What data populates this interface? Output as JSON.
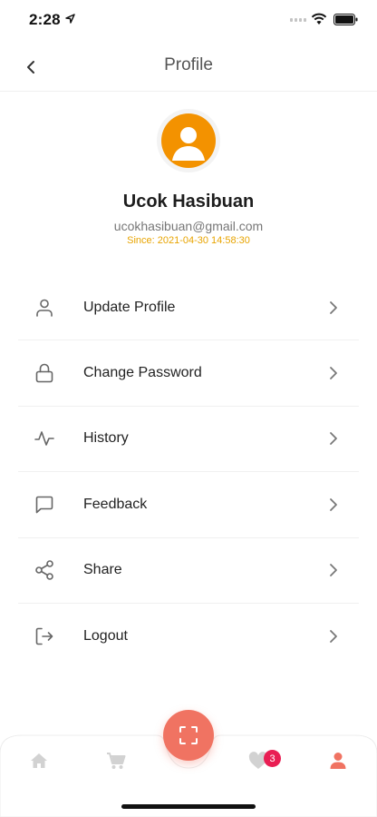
{
  "status_bar": {
    "time": "2:28"
  },
  "nav": {
    "title": "Profile"
  },
  "profile": {
    "name": "Ucok Hasibuan",
    "email": "ucokhasibuan@gmail.com",
    "since": "Since: 2021-04-30 14:58:30"
  },
  "menu": {
    "items": [
      {
        "label": "Update Profile",
        "icon": "user-icon"
      },
      {
        "label": "Change Password",
        "icon": "lock-icon"
      },
      {
        "label": "History",
        "icon": "activity-icon"
      },
      {
        "label": "Feedback",
        "icon": "message-icon"
      },
      {
        "label": "Share",
        "icon": "share-icon"
      },
      {
        "label": "Logout",
        "icon": "logout-icon"
      }
    ]
  },
  "tab_bar": {
    "favorites_badge": "3",
    "tabs": [
      "home-icon",
      "cart-icon",
      "scan-icon",
      "heart-icon",
      "person-icon"
    ]
  },
  "colors": {
    "accent": "#f07362",
    "avatar": "#f39200",
    "since_text": "#e8a400",
    "badge": "#e91e53"
  }
}
